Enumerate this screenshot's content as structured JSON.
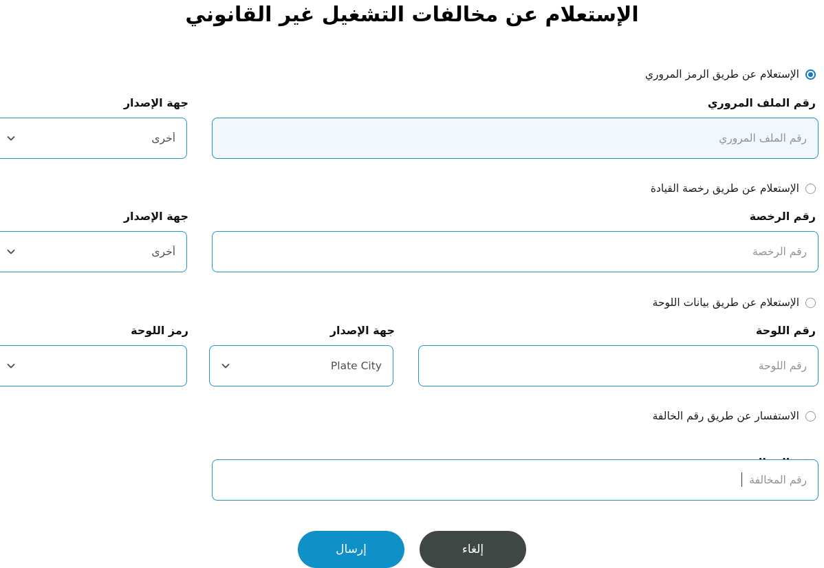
{
  "page": {
    "title": "الإستعلام عن مخالفات التشغيل غير القانوني",
    "direction": "rtl"
  },
  "colors": {
    "accent": "#0f90c6",
    "input_border": "#2196c9",
    "radio_checked": "#1479c4",
    "radio_unchecked": "#9a9a9a",
    "active_field_bg": "#f1f7fb",
    "cancel_button": "#3f4745",
    "placeholder": "#8f9499"
  },
  "options": [
    {
      "id": "traffic-code",
      "radio_label": "الإستعلام عن طريق الرمز المروري",
      "selected": true,
      "fields": [
        {
          "name": "traffic-file-number",
          "type": "text",
          "label": "رقم الملف المروري",
          "placeholder": "رقم الملف المروري",
          "value": "",
          "active": true
        },
        {
          "name": "issuing-authority",
          "type": "select",
          "label": "جهة الإصدار",
          "value": "أخرى",
          "icon": "chevron-down-icon"
        }
      ]
    },
    {
      "id": "driving-license",
      "radio_label": "الإستعلام عن طريق رخصة القيادة",
      "selected": false,
      "fields": [
        {
          "name": "license-number",
          "type": "text",
          "label": "رقم الرخصة",
          "placeholder": "رقم الرخصة",
          "value": "",
          "active": false
        },
        {
          "name": "issuing-authority",
          "type": "select",
          "label": "جهة الإصدار",
          "value": "أخرى",
          "icon": "chevron-down-icon"
        }
      ]
    },
    {
      "id": "plate-data",
      "radio_label": "الإستعلام عن طريق بيانات اللوحة",
      "selected": false,
      "fields": [
        {
          "name": "plate-number",
          "type": "text",
          "label": "رقم اللوحة",
          "placeholder": "رقم اللوحة",
          "value": "",
          "active": false
        },
        {
          "name": "plate-issuing-authority",
          "type": "select",
          "label": "جهة الإصدار",
          "value": "Plate City",
          "icon": "chevron-down-icon"
        },
        {
          "name": "plate-code",
          "type": "select",
          "label": "رمز اللوحة",
          "value": "",
          "icon": "chevron-down-icon"
        }
      ]
    },
    {
      "id": "violation-number",
      "radio_label": "الاستفسار عن طريق رقم الخالفة",
      "selected": false,
      "fields": [
        {
          "name": "violation-number",
          "type": "text",
          "label": "رقم المخالفة",
          "placeholder": "رقم المخالفة",
          "value": "",
          "active": false,
          "focused": true
        }
      ]
    }
  ],
  "actions": {
    "submit_label": "إرسال",
    "cancel_label": "إلغاء"
  }
}
